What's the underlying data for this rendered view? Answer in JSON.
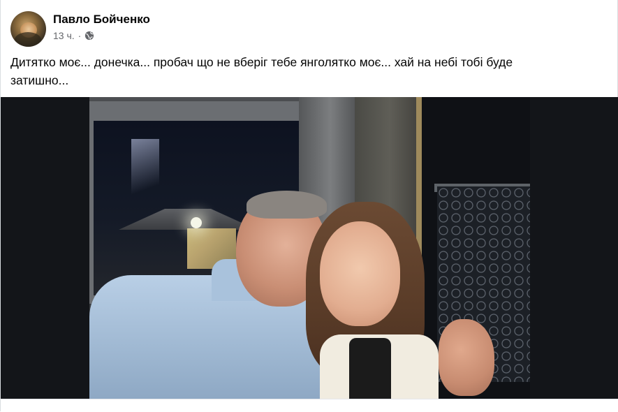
{
  "post": {
    "author": "Павло Бойченко",
    "time": "13 ч.",
    "separator": "·",
    "privacy_icon": "globe-icon",
    "text": "Дитятко моє... донечка... пробач що не вберіг тебе янголятко моє... хай на небі тобі буде затишно..."
  },
  "colors": {
    "text": "#050505",
    "secondary_text": "#65676b",
    "media_background": "#131519"
  }
}
